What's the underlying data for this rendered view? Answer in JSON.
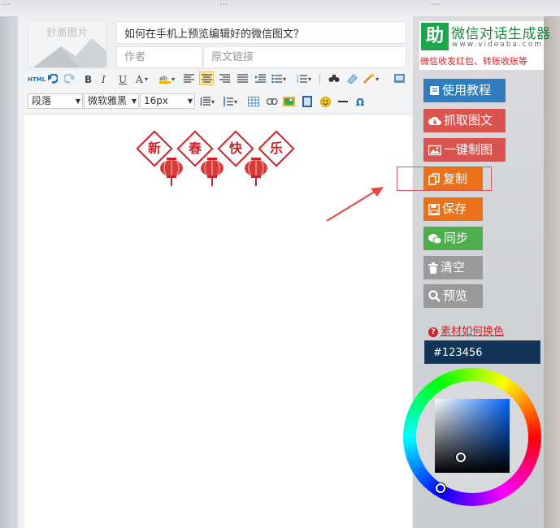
{
  "top_strip": {
    "fragments": [
      "…",
      "…",
      "…"
    ]
  },
  "cover": {
    "label": "封面图片"
  },
  "article": {
    "title_value": "如何在手机上预览编辑好的微信图文？",
    "author_placeholder": "作者",
    "link_placeholder": "原文链接"
  },
  "toolbar": {
    "html_label": "HTML",
    "bold": "B",
    "italic": "I",
    "underline": "U",
    "font_color": "A",
    "paragraph_select": "段落",
    "font_family_select": "微软雅黑",
    "font_size_select": "16px",
    "omega": "Ω"
  },
  "document": {
    "banner_chars": [
      "新",
      "春",
      "快",
      "乐"
    ]
  },
  "logo": {
    "mark": "助",
    "title": "微信对话生成器",
    "url": "www.videaba.com",
    "slogan": "微信收发红包、转账收账等"
  },
  "buttons": [
    {
      "label": "使用教程",
      "icon": "book-icon",
      "color": "#2d7dbf"
    },
    {
      "label": "抓取图文",
      "icon": "cloud-download-icon",
      "color": "#d9534f"
    },
    {
      "label": "一键制图",
      "icon": "image-icon",
      "color": "#d9534f"
    },
    {
      "label": "复制",
      "icon": "copy-icon",
      "color": "#e8711a"
    },
    {
      "label": "保存",
      "icon": "save-icon",
      "color": "#e8711a"
    },
    {
      "label": "同步",
      "icon": "wechat-icon",
      "color": "#4cae4c"
    },
    {
      "label": "清空",
      "icon": "trash-icon",
      "color": "#9a9a9a"
    },
    {
      "label": "预览",
      "icon": "search-icon",
      "color": "#9a9a9a"
    }
  ],
  "color_panel": {
    "help_text": "素材如何换色",
    "hex_value": "#123456"
  },
  "colors": {
    "brand_green": "#1aa64a",
    "accent_red": "#d4202a",
    "selected_color": "#123456"
  }
}
